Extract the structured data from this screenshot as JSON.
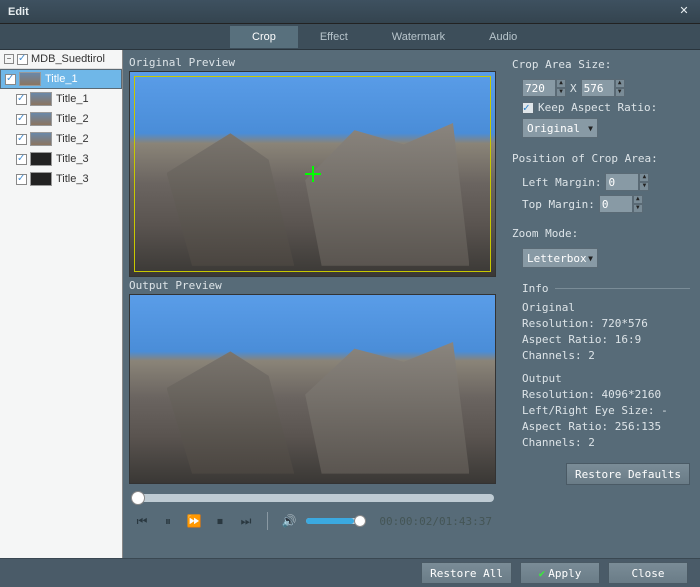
{
  "window": {
    "title": "Edit"
  },
  "tabs": {
    "crop": "Crop",
    "effect": "Effect",
    "watermark": "Watermark",
    "audio": "Audio"
  },
  "tree": {
    "root": "MDB_Suedtirol",
    "items": [
      {
        "label": "Title_1"
      },
      {
        "label": "Title_1"
      },
      {
        "label": "Title_2"
      },
      {
        "label": "Title_2"
      },
      {
        "label": "Title_3"
      },
      {
        "label": "Title_3"
      }
    ]
  },
  "preview": {
    "original_label": "Original Preview",
    "output_label": "Output Preview",
    "time": "00:00:02/01:43:37"
  },
  "crop": {
    "size_label": "Crop Area Size:",
    "width": "720",
    "x": "X",
    "height": "576",
    "keep_ratio_label": "Keep Aspect Ratio:",
    "aspect_dropdown": "Original",
    "position_label": "Position of Crop Area:",
    "left_margin_label": "Left Margin:",
    "left_margin": "0",
    "top_margin_label": "Top Margin:",
    "top_margin": "0",
    "zoom_label": "Zoom Mode:",
    "zoom_value": "Letterbox"
  },
  "info": {
    "heading": "Info",
    "original_heading": "Original",
    "orig_resolution": "Resolution: 720*576",
    "orig_aspect": "Aspect Ratio: 16:9",
    "orig_channels": "Channels: 2",
    "output_heading": "Output",
    "out_resolution": "Resolution: 4096*2160",
    "out_eyesize": "Left/Right Eye Size: -",
    "out_aspect": "Aspect Ratio: 256:135",
    "out_channels": "Channels: 2"
  },
  "buttons": {
    "restore_defaults": "Restore Defaults",
    "restore_all": "Restore All",
    "apply": "Apply",
    "close": "Close"
  }
}
